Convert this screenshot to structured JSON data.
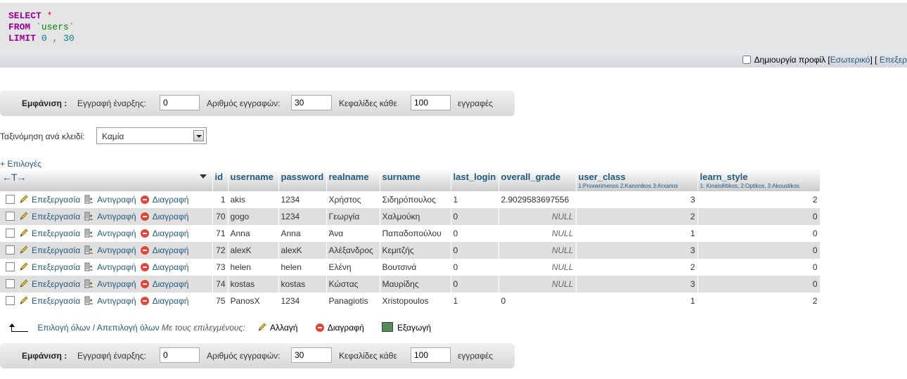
{
  "sql": {
    "select_kw": "SELECT",
    "select_rest": "*",
    "from_kw": "FROM",
    "from_table": "`users`",
    "limit_kw": "LIMIT",
    "limit_start": "0",
    "limit_sep": ",",
    "limit_count": "30"
  },
  "sql_toolbar": {
    "profiling_label": "Δημιουργία προφίλ",
    "inline_link": "Εσωτερικό",
    "edit_link": "Επεξερ"
  },
  "nav": {
    "show_label": "Εμφάνιση :",
    "start_label": "Εγγραφή έναρξης:",
    "start_value": "0",
    "count_label": "Αριθμός εγγραφών:",
    "count_value": "30",
    "headers_label": "Κεφαλίδες κάθε",
    "headers_value": "100",
    "records_label": "εγγραφές"
  },
  "sort": {
    "label": "Ταξινόμηση ανά κλειδί:",
    "value": "Καμία"
  },
  "options_link": "+ Επιλογές",
  "table": {
    "arrows": "←T→",
    "columns": [
      {
        "label": "id",
        "sub": ""
      },
      {
        "label": "username",
        "sub": ""
      },
      {
        "label": "password",
        "sub": ""
      },
      {
        "label": "realname",
        "sub": ""
      },
      {
        "label": "surname",
        "sub": ""
      },
      {
        "label": "last_login",
        "sub": ""
      },
      {
        "label": "overall_grade",
        "sub": ""
      },
      {
        "label": "user_class",
        "sub": "1:Proxwrimenos 2:Kanonikos 3:Arxarios"
      },
      {
        "label": "learn_style",
        "sub": "1: Kinaisθitikos, 2:Optikos, 3:Akoustikos"
      }
    ],
    "actions": {
      "edit": "Επεξεργασία",
      "copy": "Αντιγραφή",
      "delete": "Διαγραφή"
    },
    "rows": [
      [
        "1",
        "akis",
        "1234",
        "Χρήστος",
        "Σιδηρόπουλος",
        "1",
        "2.9029583697556",
        "3",
        "2"
      ],
      [
        "70",
        "gogo",
        "1234",
        "Γεωργία",
        "Χαλμούκη",
        "0",
        "NULL",
        "2",
        "0"
      ],
      [
        "71",
        "Anna",
        "Anna",
        "Άνα",
        "Παπαδοπούλου",
        "0",
        "NULL",
        "1",
        "0"
      ],
      [
        "72",
        "alexK",
        "alexK",
        "Αλέξανδρος",
        "Κεμιτζής",
        "0",
        "NULL",
        "3",
        "0"
      ],
      [
        "73",
        "helen",
        "helen",
        "Ελένη",
        "Βουτσινά",
        "0",
        "NULL",
        "2",
        "0"
      ],
      [
        "74",
        "kostas",
        "kostas",
        "Κώστας",
        "Μαυρίδης",
        "0",
        "NULL",
        "3",
        "0"
      ],
      [
        "75",
        "PanosX",
        "1234",
        "Panagiotis",
        "Xristopoulos",
        "1",
        "0",
        "1",
        "2"
      ]
    ]
  },
  "bulk": {
    "select_all": "Επιλογή όλων",
    "separator": "/",
    "deselect_all": "Απεπιλογή όλων",
    "with_selected": "Με τους επιλεγμένους:",
    "change": "Αλλαγή",
    "delete": "Διαγραφή",
    "export": "Εξαγωγή"
  },
  "colors": {
    "link": "#235a81",
    "keyword": "#990099",
    "row_alt": "#dfdfdf"
  }
}
